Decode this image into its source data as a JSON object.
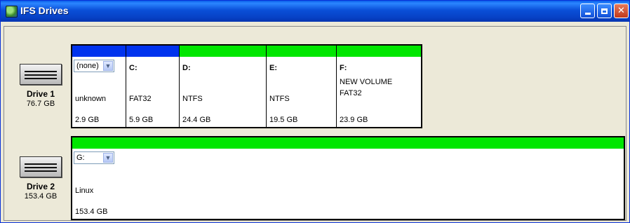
{
  "window": {
    "title": "IFS Drives",
    "app_icon": "ifs-drives-icon",
    "controls": [
      "minimize-icon",
      "maximize-icon",
      "close-icon"
    ]
  },
  "colors": {
    "fat32_bar": "#0033ee",
    "ntfs_bar": "#00e600",
    "titlebar": "#0a4fd8"
  },
  "drives": [
    {
      "name": "Drive 1",
      "size": "76.7 GB",
      "partitions": [
        {
          "letter": "(none)",
          "dropdown": true,
          "label": "",
          "fs": "unknown",
          "size": "2.9 GB",
          "bar": "#0033ee"
        },
        {
          "letter": "C:",
          "dropdown": false,
          "label": "",
          "fs": "FAT32",
          "size": "5.9 GB",
          "bar": "#0033ee"
        },
        {
          "letter": "D:",
          "dropdown": false,
          "label": "",
          "fs": "NTFS",
          "size": "24.4 GB",
          "bar": "#00e600"
        },
        {
          "letter": "E:",
          "dropdown": false,
          "label": "",
          "fs": "NTFS",
          "size": "19.5 GB",
          "bar": "#00e600"
        },
        {
          "letter": "F:",
          "dropdown": false,
          "label": "NEW VOLUME",
          "fs": "FAT32",
          "size": "23.9 GB",
          "bar": "#00e600"
        }
      ]
    },
    {
      "name": "Drive 2",
      "size": "153.4 GB",
      "partitions": [
        {
          "letter": "G:",
          "dropdown": true,
          "label": "",
          "fs": "Linux",
          "size": "153.4 GB",
          "bar": "#00e600"
        }
      ]
    }
  ]
}
